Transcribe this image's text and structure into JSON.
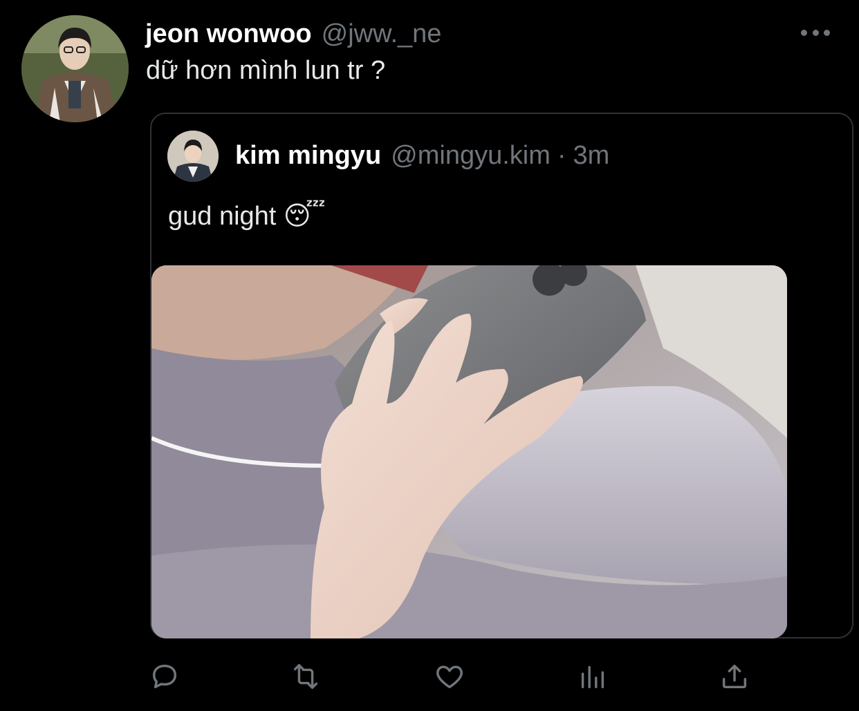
{
  "tweet": {
    "author_name": "jeon wonwoo",
    "author_handle": "@jww._ne",
    "text": "dữ hơn mình lun tr ?",
    "more_icon": "more-horizontal-icon"
  },
  "quoted_tweet": {
    "author_name": "kim mingyu",
    "author_handle": "@mingyu.kim",
    "separator": "·",
    "time": "3m",
    "text": "gud night 😴"
  },
  "actions": [
    {
      "name": "reply",
      "icon": "reply-icon"
    },
    {
      "name": "retweet",
      "icon": "retweet-icon"
    },
    {
      "name": "like",
      "icon": "heart-icon"
    },
    {
      "name": "analytics",
      "icon": "analytics-icon"
    },
    {
      "name": "share",
      "icon": "share-icon"
    }
  ],
  "colors": {
    "background": "#000000",
    "primary_text": "#e7e9ea",
    "secondary_text": "#71767b",
    "border": "#2f3336"
  }
}
